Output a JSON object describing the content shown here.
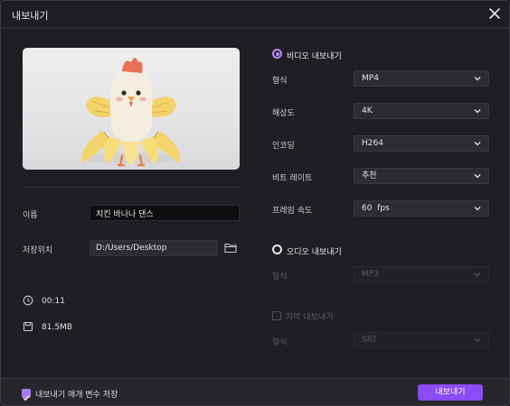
{
  "window": {
    "title": "내보내기"
  },
  "left": {
    "name_label": "이름",
    "name_value": "치킨 바나나 댄스",
    "location_label": "저장위치",
    "location_value": "D:/Users/Desktop",
    "duration": "00:11",
    "file_size": "81.5MB"
  },
  "video": {
    "section_label": "비디오 내보내기",
    "selected": true,
    "rows": [
      {
        "label": "형식",
        "value": "MP4"
      },
      {
        "label": "해상도",
        "value": "4K"
      },
      {
        "label": "인코딩",
        "value": "H264"
      },
      {
        "label": "비트 레이트",
        "value": "추천"
      },
      {
        "label": "프레임 속도",
        "value": "60  fps"
      }
    ]
  },
  "audio": {
    "section_label": "오디오 내보내기",
    "selected": false,
    "format_label": "형식",
    "format_value": "MP3"
  },
  "subtitle": {
    "checkbox_label": "자막 내보내기",
    "checked": false,
    "format_label": "형식",
    "format_value": "SRT"
  },
  "footer": {
    "remember_label": "내보내기 매개 변수 저장",
    "remember_checked": true,
    "export_button": "내보내기"
  },
  "colors": {
    "accent": "#8b4bf5",
    "radio_accent": "#b78cff",
    "background": "#1f1f23"
  }
}
